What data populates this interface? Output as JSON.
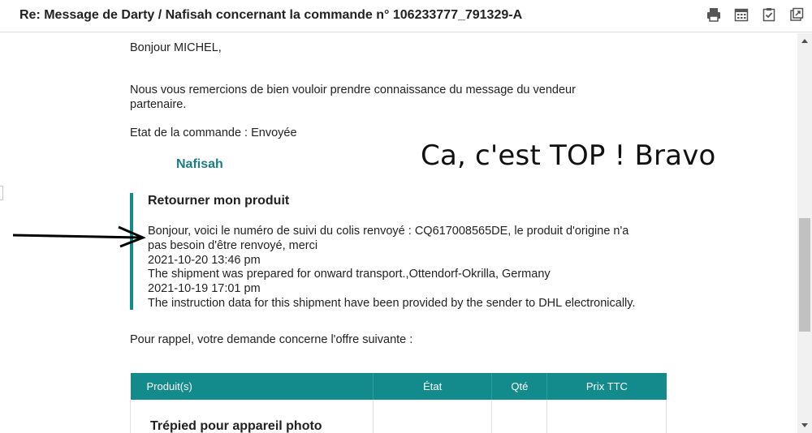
{
  "header": {
    "subject": "Re: Message de Darty / Nafisah concernant la commande n° 106233777_791329-A",
    "tools": [
      "printer-icon",
      "calendar-icon",
      "task-icon",
      "popout-icon"
    ]
  },
  "message": {
    "greeting": "Bonjour MICHEL,",
    "intro_line1": "Nous vous remercions de bien vouloir prendre connaissance du message du vendeur",
    "intro_line2": "partenaire.",
    "order_state": "Etat de la commande : Envoyée",
    "seller_name": "Nafisah",
    "overlay_comment": "Ca, c'est TOP ! Bravo",
    "quote": {
      "title": "Retourner mon produit",
      "lines": [
        "Bonjour, voici le numéro de suivi du colis renvoyé : CQ617008565DE, le produit d'origine n'a",
        "pas besoin d'être renvoyé, merci",
        "2021-10-20 13:46 pm",
        "The shipment was prepared for onward transport.,Ottendorf-Okrilla, Germany",
        "2021-10-19 17:01 pm",
        "The instruction data for this shipment have been provided by the sender to DHL electronically."
      ]
    },
    "reminder": "Pour rappel, votre demande concerne l'offre suivante :"
  },
  "table": {
    "headers": [
      "Produit(s)",
      "État",
      "Qté",
      "Prix TTC"
    ],
    "rows": [
      {
        "product": "Trépied pour appareil photo",
        "state": "",
        "qty": "",
        "price": ""
      }
    ]
  },
  "colors": {
    "accent": "#138a8c",
    "seller": "#1a7e84"
  }
}
